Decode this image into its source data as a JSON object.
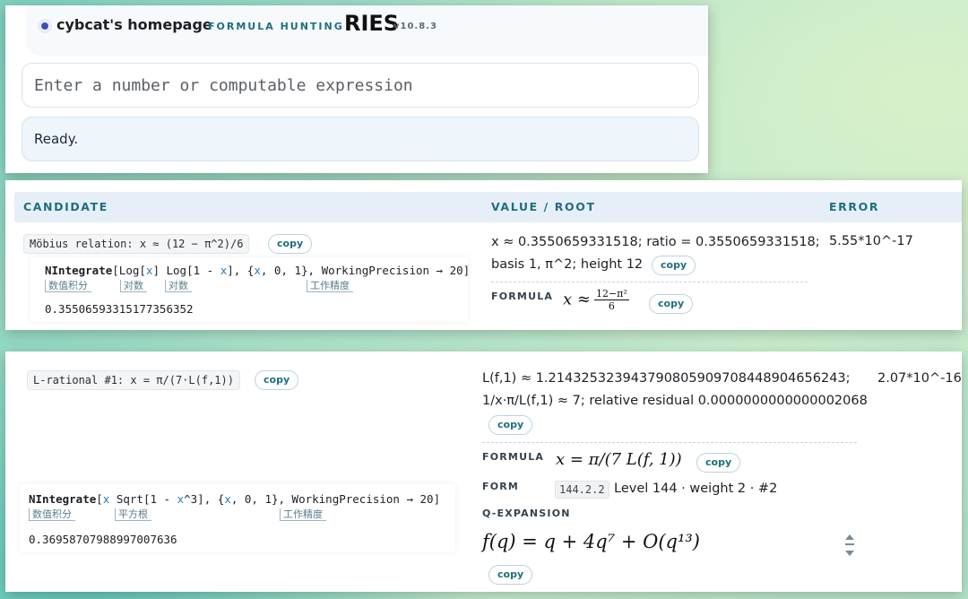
{
  "header": {
    "title": "cybcat's homepage",
    "subtitle": "FORMULA HUNTING",
    "app": "RIES",
    "version": "v10.8.3"
  },
  "search": {
    "placeholder": "Enter a number or computable expression",
    "value": ""
  },
  "status": "Ready.",
  "columns": {
    "candidate": "CANDIDATE",
    "value_root": "VALUE / ROOT",
    "error": "ERROR"
  },
  "copy_label": "copy",
  "results": [
    {
      "candidate": "Möbius relation: x ≈ (12 − π^2)/6",
      "code": {
        "fn": "NIntegrate",
        "parts": [
          "[Log[",
          "x",
          "] Log[1 - ",
          "x",
          "], {",
          "x",
          ", 0, 1}, WorkingPrecision → 20]"
        ],
        "annotations": [
          "数值积分",
          "对数",
          "对数",
          "工作精度"
        ],
        "output": "0.35506593315177356352"
      },
      "value_lines": [
        "x ≈ 0.3550659331518; ratio = 0.3550659331518;",
        "basis 1, π^2; height 12"
      ],
      "formula_label": "FORMULA",
      "formula": {
        "lhs": "x ≈",
        "num": "12−π²",
        "den": "6"
      },
      "error": "5.55*10^-17"
    },
    {
      "candidate": "L-rational #1: x = π/(7·L(f,1))",
      "code": {
        "fn": "NIntegrate",
        "parts": [
          "[",
          "x",
          " Sqrt[1 - ",
          "x",
          "^3], {",
          "x",
          ", 0, 1}, WorkingPrecision → 20]"
        ],
        "annotations": [
          "数值积分",
          "平方根",
          "工作精度"
        ],
        "output": "0.36958707988997007636"
      },
      "value_lines": [
        "L(f,1) ≈ 1.2143253239437908059097084489046562​43;",
        "1/x·π/L(f,1) ≈ 7; relative residual 0.0000000000000002068"
      ],
      "formula_label": "FORMULA",
      "formula": "x = π/(7 L(f, 1))",
      "form_label": "FORM",
      "form_chip": "144.2.2",
      "form_text": "Level 144 · weight 2 · #2",
      "qexp_label": "Q-EXPANSION",
      "qexp": "f(q) = q + 4q⁷ + O(q¹³)",
      "error": "2.07*10^-16"
    }
  ]
}
